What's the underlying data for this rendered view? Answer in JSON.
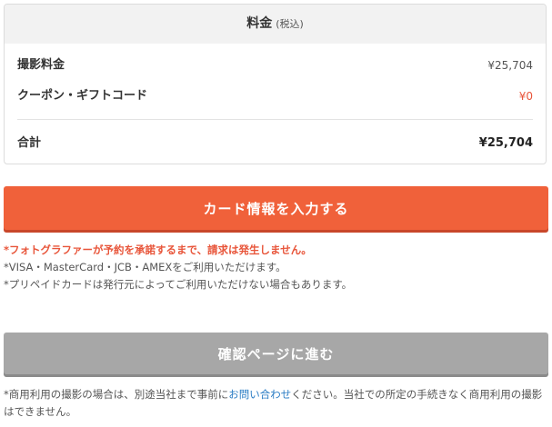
{
  "price_box": {
    "title": "料金",
    "title_note": "(税込)",
    "rows": [
      {
        "label": "撮影料金",
        "value": "¥25,704"
      },
      {
        "label": "クーポン・ギフトコード",
        "value": "¥0"
      }
    ],
    "total": {
      "label": "合計",
      "value": "¥25,704"
    }
  },
  "card_button": {
    "label": "カード情報を入力する"
  },
  "notes": {
    "warning": "*フォトグラファーが予約を承諾するまで、請求は発生しません。",
    "cards": "*VISA・MasterCard・JCB・AMEXをご利用いただけます。",
    "prepaid": "*プリペイドカードは発行元によってご利用いただけない場合もあります。"
  },
  "confirm_button": {
    "label": "確認ページに進む"
  },
  "footer": {
    "prefix": "*商用利用の撮影の場合は、別途当社まで事前に",
    "link": "お問い合わせ",
    "suffix": "ください。当社での所定の手続きなく商用利用の撮影はできません。"
  },
  "colors": {
    "accent": "#f0613a",
    "discount": "#e8553a",
    "disabled": "#a7a7a7",
    "link": "#2a7cc4"
  }
}
